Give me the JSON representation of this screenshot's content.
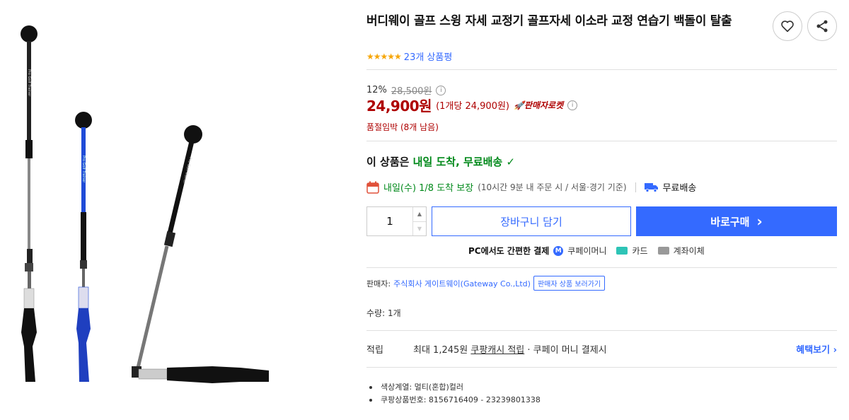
{
  "product": {
    "title": "버디웨이 골프 스윙 자세 교정기 골프자세 이소라 교정 연습기 백돌이 탈출",
    "stars": "★★★★★",
    "review_count": "23개 상품평",
    "shaft_print": "Pro Golf Trainer"
  },
  "actions": {
    "heart_icon": "heart-icon",
    "share_icon": "share-icon"
  },
  "price": {
    "discount_rate": "12%",
    "original_price": "28,500원",
    "sale_price": "24,900원",
    "unit_price": "(1개당 24,900원)",
    "rocket_badge": "🚀판매자로켓",
    "stock_notice": "품절임박 (8개 남음)"
  },
  "delivery": {
    "prefix": "이 상품은 ",
    "highlight": "내일 도착, 무료배송",
    "check": "✓",
    "arrival": "내일(수) 1/8 도착 보장",
    "arrival_detail": "(10시간 9분  내 주문 시 / 서울·경기 기준)",
    "free_shipping": "무료배송"
  },
  "purchase": {
    "quantity": "1",
    "cart_label": "장바구니 담기",
    "buy_label": "바로구매",
    "buy_chevron": "›"
  },
  "payment": {
    "title": "PC에서도 간편한 결제",
    "coupay_mark": "M",
    "coupay": "쿠페이머니",
    "card": "카드",
    "bank": "계좌이체"
  },
  "seller": {
    "label": "판매자:",
    "name": "주식회사 게이트웨이(Gateway Co.,Ltd)",
    "button": "판매자 상품 보러가기"
  },
  "quantity_info": "수량: 1개",
  "reward": {
    "label": "적립",
    "prefix": "최대 1,245원 ",
    "cash": "쿠팡캐시 적립",
    "suffix": " · 쿠페이 머니 결제시",
    "benefit_link": "혜택보기 ›"
  },
  "specs": [
    "색상계열: 멀티(혼합)컬러",
    "쿠팡상품번호: 8156716409 - 23239801338"
  ],
  "colors": {
    "accent": "#346aff",
    "price": "#ae0000",
    "delivery_green": "#00891a",
    "star": "#f6a609",
    "trainer_blue": "#1f4bd8"
  }
}
